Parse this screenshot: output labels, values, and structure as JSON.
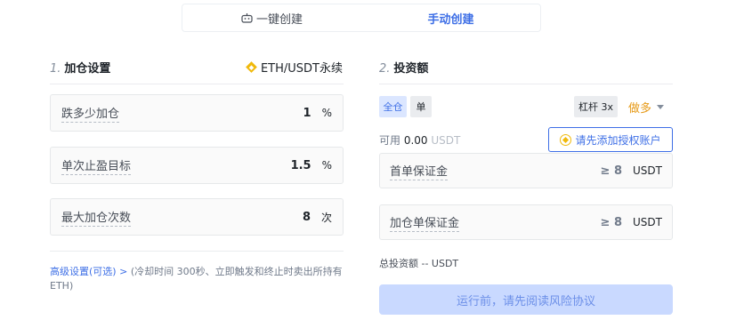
{
  "tabs": {
    "auto_label": "一键创建",
    "manual_label": "手动创建"
  },
  "left": {
    "step": "1.",
    "title": "加仓设置",
    "pair": "ETH/USDT永续",
    "fields": [
      {
        "label": "跌多少加仓",
        "value": "1",
        "unit": "%"
      },
      {
        "label": "单次止盈目标",
        "value": "1.5",
        "unit": "%"
      },
      {
        "label": "最大加仓次数",
        "value": "8",
        "unit": "次"
      }
    ],
    "advanced_link": "高级设置(可选)",
    "advanced_arrow": ">",
    "advanced_note": "(冷却时间 300秒、立即触发和终止时卖出所持有ETH)"
  },
  "right": {
    "step": "2.",
    "title": "投资额",
    "margin_full": "全仓",
    "margin_single": "单",
    "leverage": "杠杆 3x",
    "direction": "做多",
    "available_label": "可用",
    "available_amount": "0.00",
    "available_currency": "USDT",
    "auth_button": "请先添加授权账户",
    "fields": [
      {
        "label": "首单保证金",
        "min": "≥ 8",
        "unit": "USDT"
      },
      {
        "label": "加仓单保证金",
        "min": "≥ 8",
        "unit": "USDT"
      }
    ],
    "total": "总投资额 -- USDT",
    "submit": "运行前，请先阅读风险协议"
  },
  "colors": {
    "accent": "#3e6fe6",
    "long": "#e69a18",
    "submit_bg": "#c9d9ff"
  }
}
